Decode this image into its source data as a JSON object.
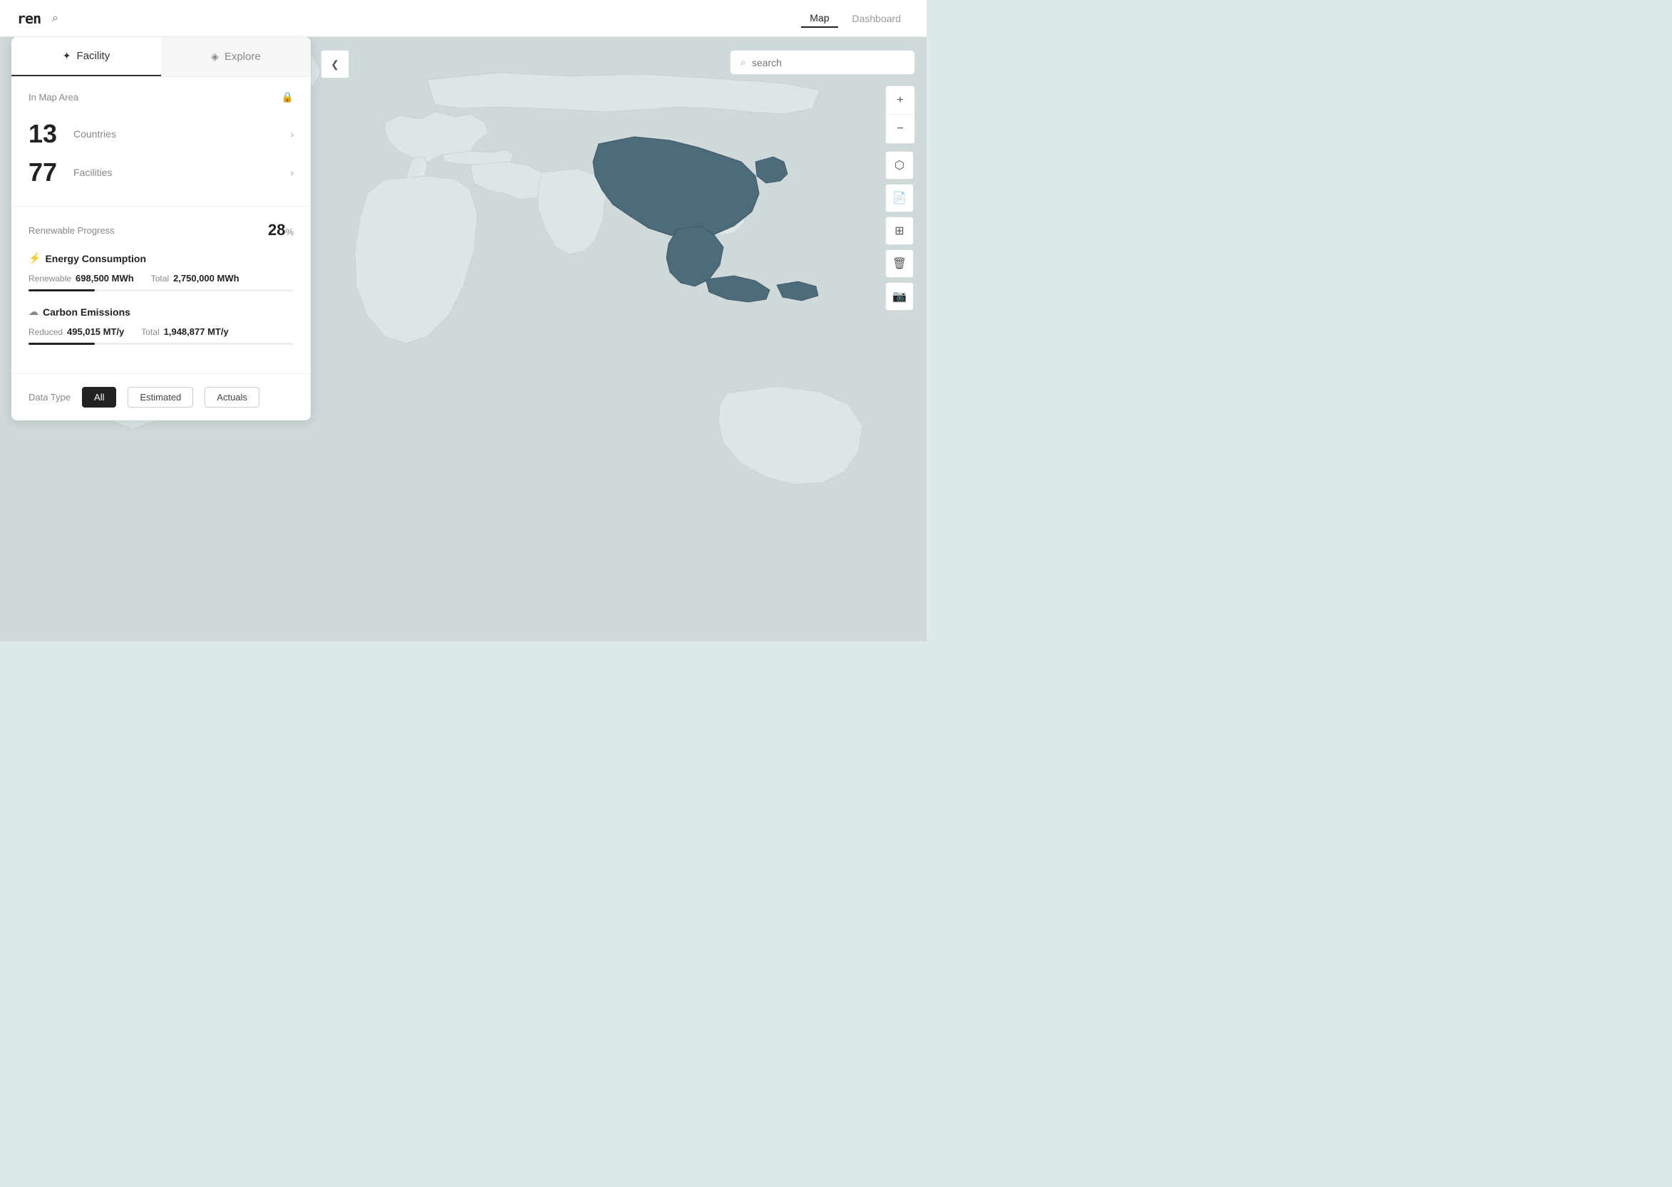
{
  "app": {
    "logo": "ren",
    "nav": {
      "map_label": "Map",
      "dashboard_label": "Dashboard"
    }
  },
  "search": {
    "placeholder": "search"
  },
  "sidebar": {
    "tab_facility": "Facility",
    "tab_explore": "Explore",
    "map_area": {
      "title": "In Map Area",
      "countries_count": "13",
      "countries_label": "Countries",
      "facilities_count": "77",
      "facilities_label": "Facilities"
    },
    "renewable_progress": {
      "label": "Renewable Progress",
      "value": "28",
      "unit": "%"
    },
    "energy_consumption": {
      "title": "Energy Consumption",
      "renewable_label": "Renewable",
      "renewable_value": "698,500 MWh",
      "total_label": "Total",
      "total_value": "2,750,000 MWh",
      "bar_pct": 25
    },
    "carbon_emissions": {
      "title": "Carbon Emissions",
      "reduced_label": "Reduced",
      "reduced_value": "495,015 MT/y",
      "total_label": "Total",
      "total_value": "1,948,877 MT/y",
      "bar_pct": 25
    },
    "data_type": {
      "label": "Data Type",
      "all": "All",
      "estimated": "Estimated",
      "actuals": "Actuals"
    }
  },
  "icons": {
    "logo": "ren",
    "search": "⌕",
    "lock": "🔒",
    "chevron_right": "›",
    "lightning": "⚡",
    "cloud": "☁",
    "zoom_in": "+",
    "zoom_out": "−",
    "collapse": "❮"
  }
}
